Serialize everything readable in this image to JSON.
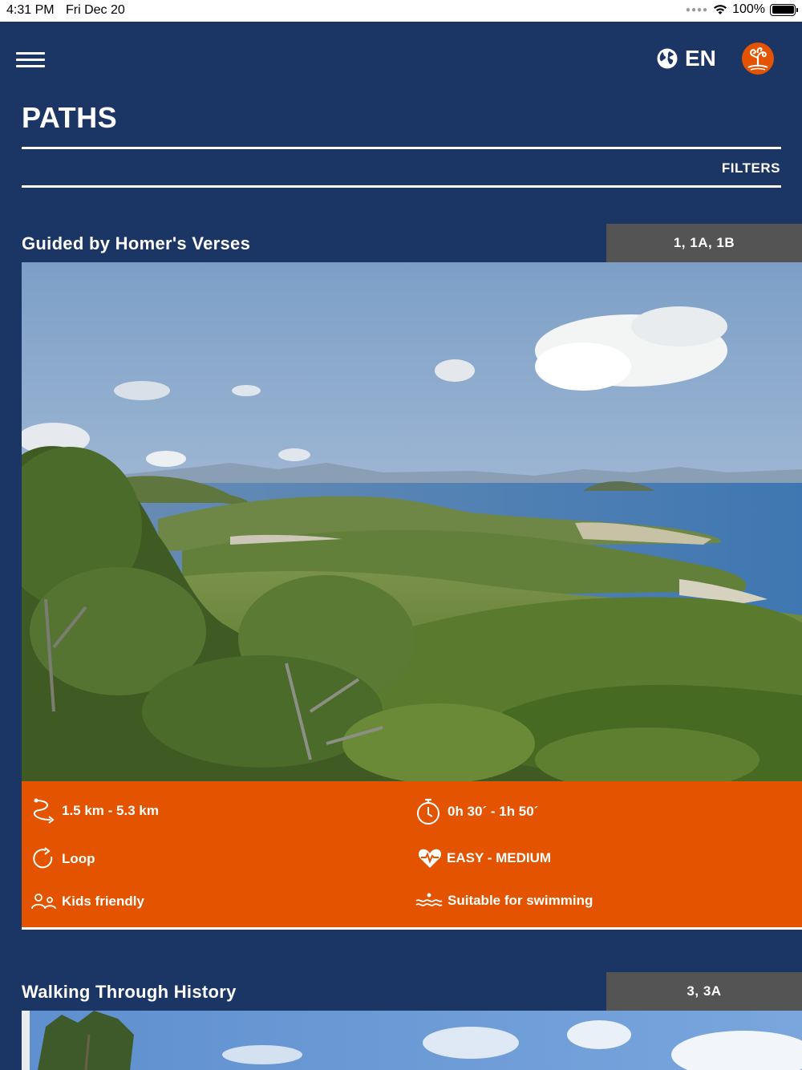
{
  "status_bar": {
    "time": "4:31 PM",
    "date": "Fri Dec 20",
    "battery": "100%"
  },
  "header": {
    "language": "EN",
    "icons": [
      "menu-icon",
      "globe-icon",
      "tree-logo-icon"
    ]
  },
  "page": {
    "title": "PATHS",
    "filters_label": "FILTERS"
  },
  "paths": [
    {
      "title": "Guided by Homer's Verses",
      "routes": "1, 1A, 1B",
      "distance": "1.5 km - 5.3 km",
      "duration": "0h 30´ - 1h 50´",
      "type": "Loop",
      "difficulty": "EASY - MEDIUM",
      "audience": "Kids friendly",
      "swimming": "Suitable for swimming"
    },
    {
      "title": "Walking Through History",
      "routes": "3, 3A"
    }
  ],
  "colors": {
    "background": "#1b3565",
    "accent": "#e35300",
    "badge": "#545454"
  }
}
